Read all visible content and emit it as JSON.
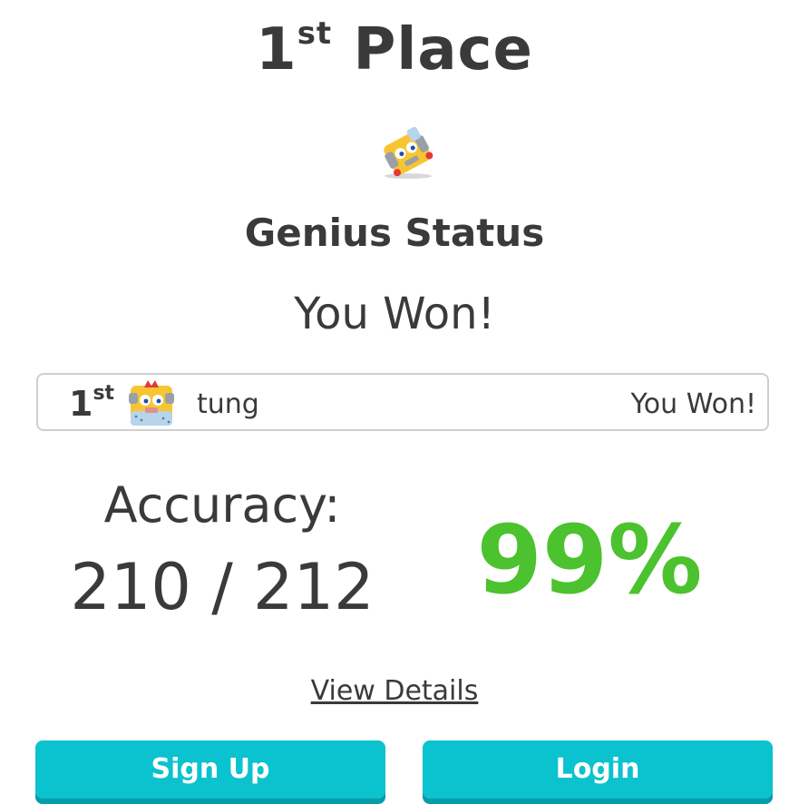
{
  "header": {
    "place_number": "1",
    "place_suffix": "st",
    "place_word": "Place"
  },
  "hero_blook_icon": "yellow-blook-robot-icon",
  "status_label": "Genius Status",
  "result_text": "You Won!",
  "leaderboard": {
    "rows": [
      {
        "place_number": "1",
        "place_suffix": "st",
        "avatar_icon": "yellow-blook-crown-icon",
        "name": "tung",
        "result": "You Won!"
      }
    ]
  },
  "accuracy": {
    "label": "Accuracy:",
    "fraction": "210 / 212",
    "percent": "99%"
  },
  "links": {
    "view_details": "View Details"
  },
  "buttons": {
    "signup": "Sign Up",
    "login": "Login"
  },
  "colors": {
    "accent_green": "#4bc22e",
    "button_teal": "#0bc2cf",
    "text_dark": "#3a3a3a"
  }
}
